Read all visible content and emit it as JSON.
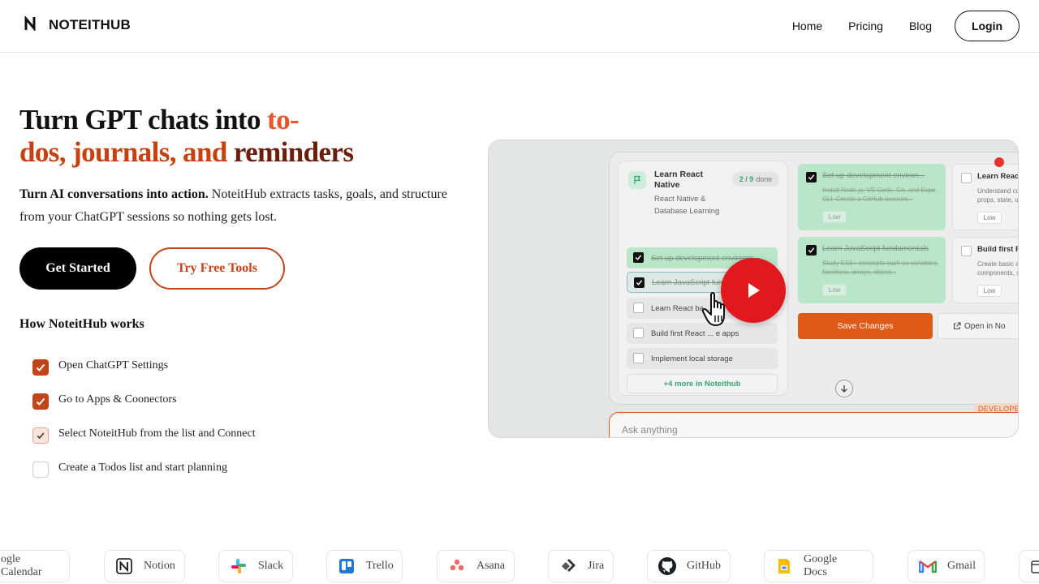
{
  "brand": {
    "mark": "N",
    "name": "NOTEITHUB"
  },
  "nav": {
    "items": [
      "Home",
      "Pricing",
      "Blog"
    ],
    "login": "Login"
  },
  "hero": {
    "title_plain": "Turn GPT chats into ",
    "title_accent_1": "to-",
    "title_accent_2": "dos, journals, and ",
    "title_accent_3": "reminders",
    "sub_bold": "Turn AI conversations into action.",
    "sub_rest": " NoteitHub extracts tasks, goals, and structure from your ChatGPT sessions so nothing gets lost.",
    "cta_primary": "Get Started",
    "cta_secondary": "Try Free Tools"
  },
  "how": {
    "title": "How NoteitHub works",
    "steps": [
      {
        "label": "Open ChatGPT Settings",
        "state": "checked"
      },
      {
        "label": "Go to Apps & Coonectors",
        "state": "checked"
      },
      {
        "label": "Select NoteitHub from the list and Connect",
        "state": "partial"
      },
      {
        "label": "Create a Todos list and start planning",
        "state": "unchecked"
      }
    ]
  },
  "video": {
    "list_title": "Learn React Native",
    "list_desc": "React Native & Database Learning",
    "progress_done": "2 / 9",
    "progress_label": "done",
    "tasks": [
      {
        "label": "Set up development environm...",
        "state": "done"
      },
      {
        "label": "Learn JavaScript fun...",
        "state": "focus"
      },
      {
        "label": "Learn React ba...",
        "state": "plain"
      },
      {
        "label": "Build first React ... e apps",
        "state": "plain"
      },
      {
        "label": "Implement local storage",
        "state": "plain"
      }
    ],
    "more_link": "+4 more in Noteithub",
    "cards": [
      {
        "title": "Set up development environ...",
        "desc": "Install Node.js, VS Code, Git, and Expo CLI. Create a GitHub account...",
        "priority": "Low"
      },
      {
        "title": "Learn JavaScript fundamentals",
        "desc": "Study ES6+ concepts such as variables, functions, arrays, object...",
        "priority": "Low"
      },
      {
        "title": "Learn React",
        "desc": "Understand co props, state, u",
        "priority": "Low"
      },
      {
        "title": "Build first R",
        "desc": "Create basic a components, s",
        "priority": "Low"
      }
    ],
    "save_btn": "Save Changes",
    "open_btn": "Open in No",
    "dev_tag": "DEVELOPER",
    "ask_placeholder": "Ask anything"
  },
  "integrations": [
    {
      "name": "ogle Calendar",
      "icon": "google-calendar-icon"
    },
    {
      "name": "Notion",
      "icon": "notion-icon"
    },
    {
      "name": "Slack",
      "icon": "slack-icon"
    },
    {
      "name": "Trello",
      "icon": "trello-icon"
    },
    {
      "name": "Asana",
      "icon": "asana-icon"
    },
    {
      "name": "Jira",
      "icon": "jira-icon"
    },
    {
      "name": "GitHub",
      "icon": "github-icon"
    },
    {
      "name": "Google Docs",
      "icon": "google-docs-icon"
    },
    {
      "name": "Gmail",
      "icon": "gmail-icon"
    }
  ],
  "colors": {
    "accent": "#c2441a",
    "accent_light": "#e8542a",
    "accent_dark": "#6b1d0b",
    "play": "#e0191f",
    "green": "#b9e6c9"
  }
}
